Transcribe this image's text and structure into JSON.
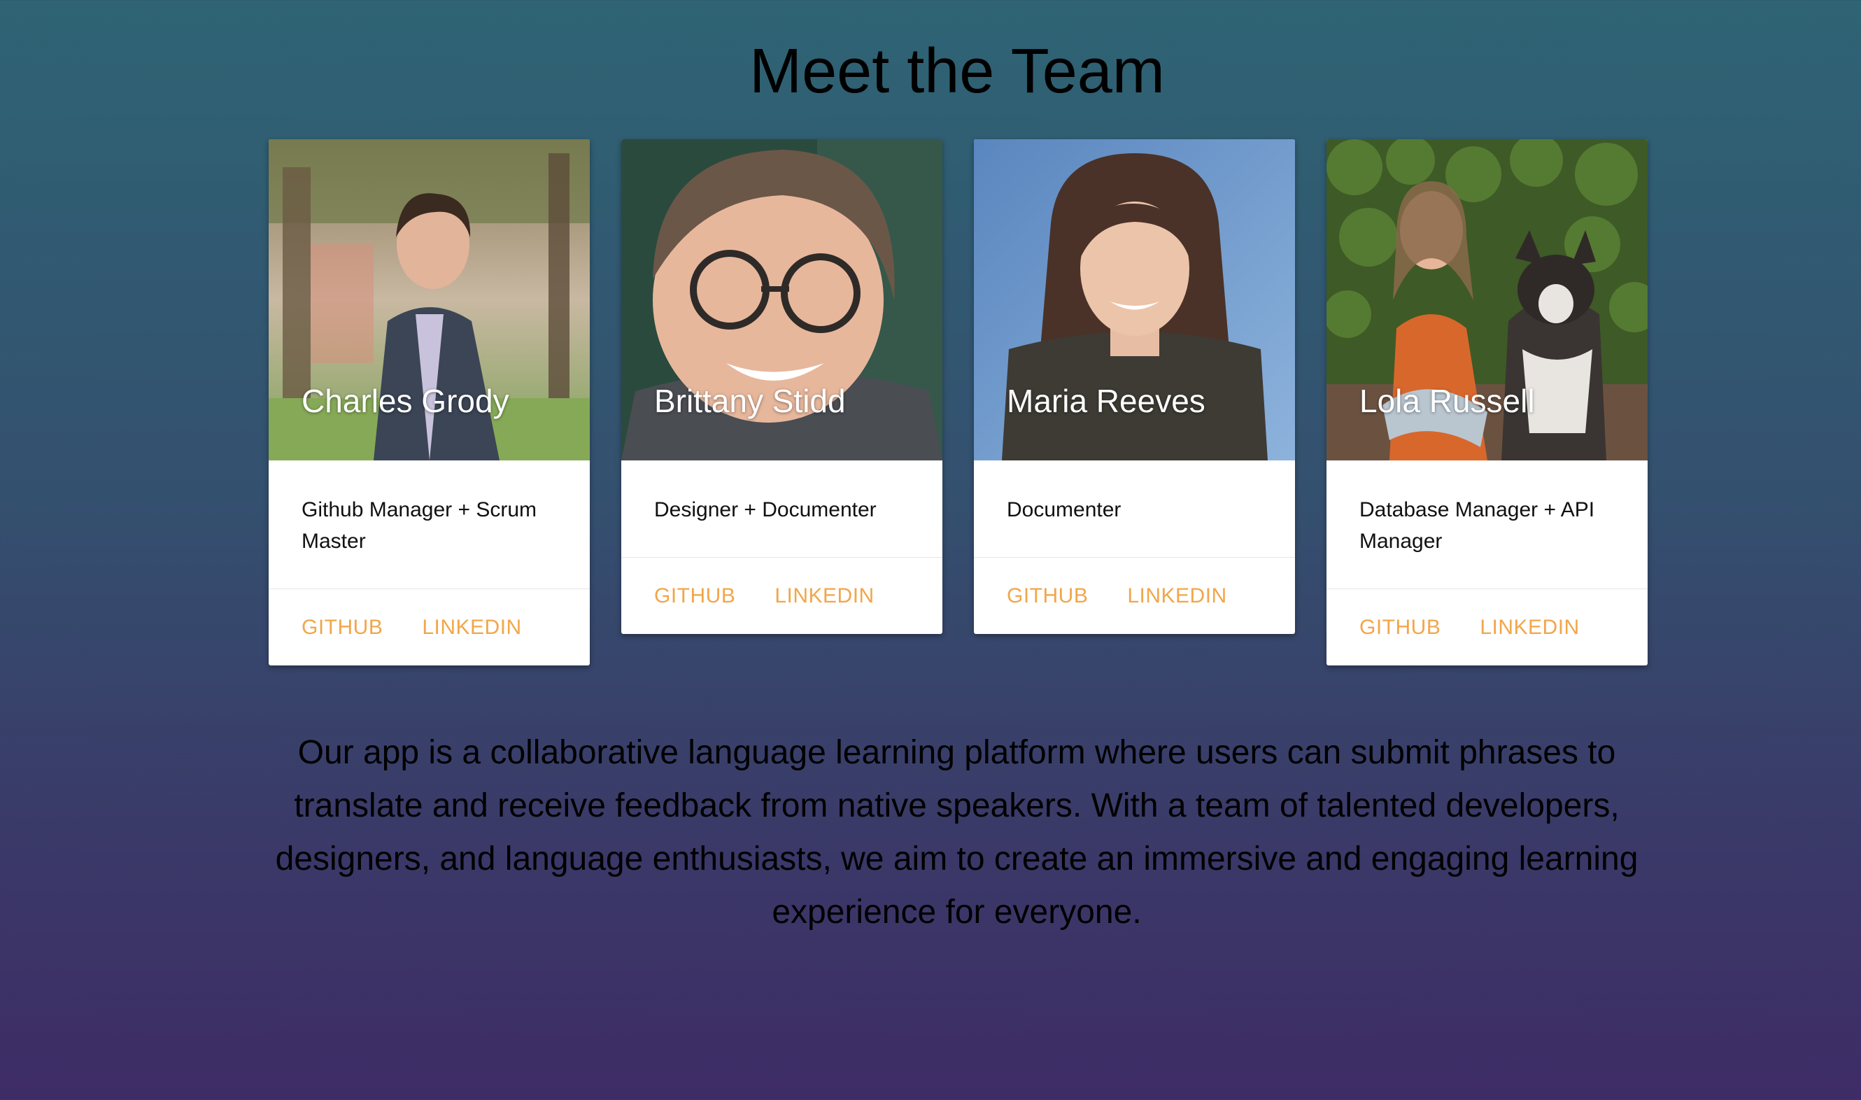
{
  "page": {
    "title": "Meet the Team",
    "about": "Our app is a collaborative language learning platform where users can submit phrases to translate and receive feedback from native speakers. With a team of talented developers, designers, and language enthusiasts, we aim to create an immersive and engaging learning experience for everyone."
  },
  "team": [
    {
      "name": "Charles Grody",
      "role": "Github Manager + Scrum Master",
      "github_label": "GITHUB",
      "linkedin_label": "LINKEDIN"
    },
    {
      "name": "Brittany Stidd",
      "role": "Designer + Documenter",
      "github_label": "GITHUB",
      "linkedin_label": "LINKEDIN"
    },
    {
      "name": "Maria Reeves",
      "role": "Documenter",
      "github_label": "GITHUB",
      "linkedin_label": "LINKEDIN"
    },
    {
      "name": "Lola Russell",
      "role": "Database Manager + API Manager",
      "github_label": "GITHUB",
      "linkedin_label": "LINKEDIN"
    }
  ],
  "colors": {
    "link": "#f2a64a",
    "background_top": "#2e6474",
    "background_bottom": "#3e2c66"
  }
}
